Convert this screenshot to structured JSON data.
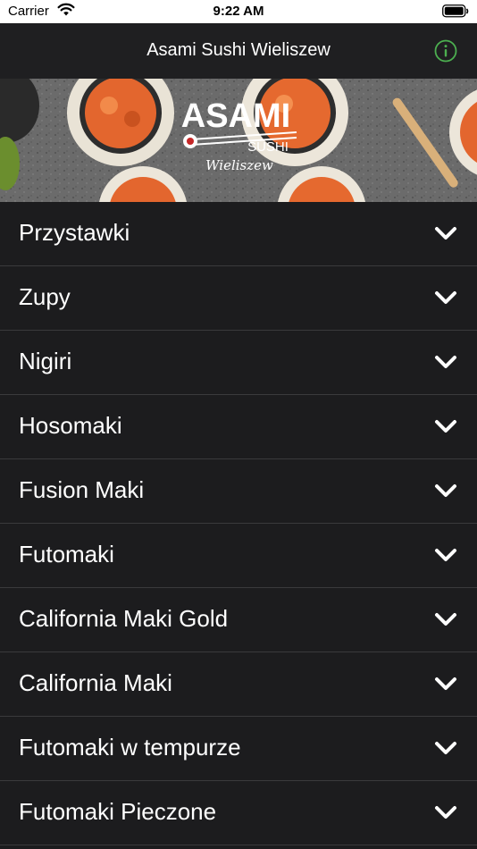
{
  "status_bar": {
    "carrier": "Carrier",
    "time": "9:22 AM"
  },
  "navbar": {
    "title": "Asami Sushi Wieliszew",
    "info_icon": "info-circle-icon",
    "accent_color": "#4caf50"
  },
  "banner": {
    "logo_text": "ASAMI",
    "logo_subtext": "SUSHI",
    "logo_script": "Wieliszew"
  },
  "menu": {
    "items": [
      {
        "label": "Przystawki"
      },
      {
        "label": "Zupy"
      },
      {
        "label": "Nigiri"
      },
      {
        "label": "Hosomaki"
      },
      {
        "label": "Fusion Maki"
      },
      {
        "label": "Futomaki"
      },
      {
        "label": "California Maki Gold"
      },
      {
        "label": "California Maki"
      },
      {
        "label": "Futomaki w tempurze"
      },
      {
        "label": "Futomaki Pieczone"
      }
    ],
    "chevron_icon": "chevron-down-icon"
  }
}
